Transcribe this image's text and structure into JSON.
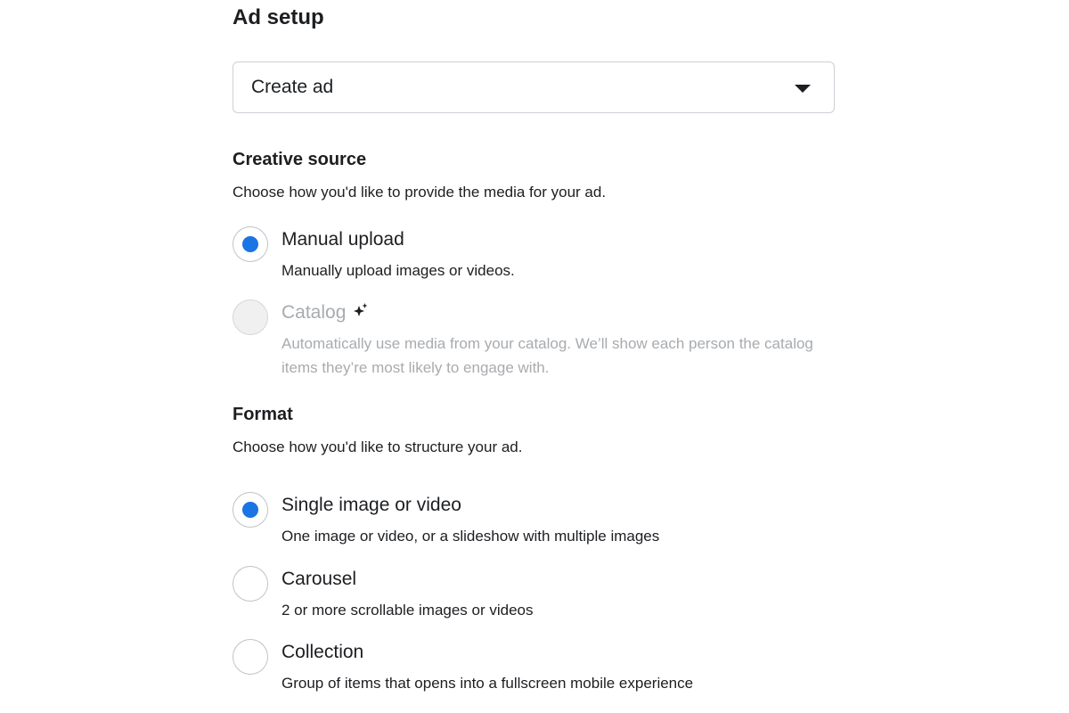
{
  "colors": {
    "accent": "#1b74e4",
    "disabled_text": "#a8abaf",
    "border": "#ccd0d5"
  },
  "ad_setup": {
    "title": "Ad setup",
    "select": {
      "value": "Create ad",
      "icon": "caret-down-icon"
    }
  },
  "creative_source": {
    "title": "Creative source",
    "description": "Choose how you'd like to provide the media for your ad.",
    "options": [
      {
        "label": "Manual upload",
        "description": "Manually upload images or videos.",
        "selected": true,
        "disabled": false
      },
      {
        "label": "Catalog",
        "icon": "sparkle-icon",
        "description": "Automatically use media from your catalog. We’ll show each person the catalog items they’re most likely to engage with.",
        "selected": false,
        "disabled": true
      }
    ]
  },
  "format": {
    "title": "Format",
    "description": "Choose how you'd like to structure your ad.",
    "options": [
      {
        "label": "Single image or video",
        "description": "One image or video, or a slideshow with multiple images",
        "selected": true,
        "disabled": false
      },
      {
        "label": "Carousel",
        "description": "2 or more scrollable images or videos",
        "selected": false,
        "disabled": false
      },
      {
        "label": "Collection",
        "description": "Group of items that opens into a fullscreen mobile experience",
        "selected": false,
        "disabled": false
      }
    ]
  }
}
